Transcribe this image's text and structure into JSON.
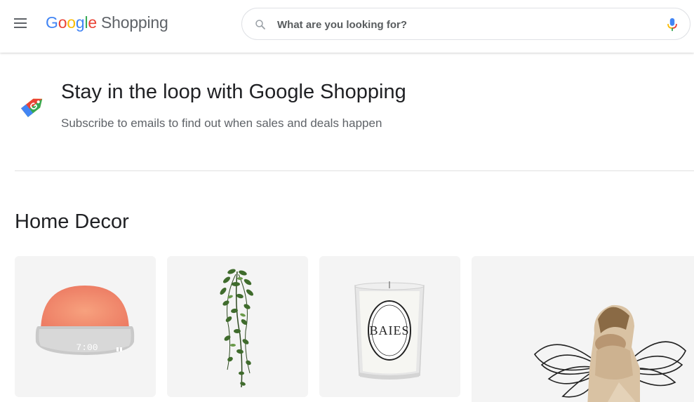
{
  "header": {
    "logo_google": [
      "G",
      "o",
      "o",
      "g",
      "l",
      "e"
    ],
    "logo_product": "Shopping",
    "search_placeholder": "What are you looking for?"
  },
  "promo": {
    "title": "Stay in the loop with Google Shopping",
    "subtitle": "Subscribe to emails to find out when sales and deals happen"
  },
  "section": {
    "title": "Home Decor",
    "products": [
      {
        "item": "sunrise-alarm-clock",
        "display_time": "7:00"
      },
      {
        "item": "hanging-plant"
      },
      {
        "item": "candle",
        "label_text": "BAIES"
      },
      {
        "item": "figurine-sculpture"
      }
    ]
  },
  "colors": {
    "google_blue": "#4285f4",
    "google_red": "#ea4335",
    "google_yellow": "#fbbc05",
    "google_green": "#34a853",
    "card_background": "#f4f4f4"
  }
}
